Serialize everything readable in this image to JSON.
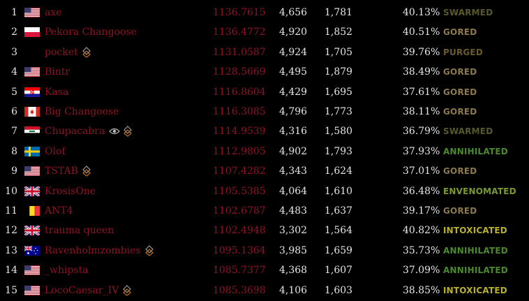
{
  "colors": {
    "background": "#000000",
    "name": "#8e1326",
    "rating": "#8e1326",
    "number": "#e6e6e6",
    "status": {
      "SWARMED": "#59582a",
      "GORED": "#8c7a4c",
      "PURGED": "#6b5a2c",
      "ANNIHILATED": "#4b8a2c",
      "ENVENOMATED": "#7a9a2c",
      "INTOXICATED": "#b8b02a"
    }
  },
  "rows": [
    {
      "rank": "1",
      "flag": "us-flag-icon",
      "name": "axe",
      "icons": [],
      "rating": "1136.7615",
      "games": "4,656",
      "wins": "1,781",
      "pct": "40.13%",
      "status": "SWARMED"
    },
    {
      "rank": "2",
      "flag": "pl-flag-icon",
      "name": "Pekora Changoose",
      "icons": [],
      "rating": "1136.4772",
      "games": "4,920",
      "wins": "1,852",
      "pct": "40.51%",
      "status": "GORED"
    },
    {
      "rank": "3",
      "flag": "",
      "name": "pocket",
      "icons": [
        "diamond-icon"
      ],
      "rating": "1131.0587",
      "games": "4,924",
      "wins": "1,705",
      "pct": "39.76%",
      "status": "PURGED"
    },
    {
      "rank": "4",
      "flag": "us-flag-icon",
      "name": "Bintr",
      "icons": [],
      "rating": "1128.5669",
      "games": "4,495",
      "wins": "1,879",
      "pct": "38.49%",
      "status": "GORED"
    },
    {
      "rank": "5",
      "flag": "hr-flag-icon",
      "name": "Kasa",
      "icons": [],
      "rating": "1116.8604",
      "games": "4,429",
      "wins": "1,695",
      "pct": "37.61%",
      "status": "GORED"
    },
    {
      "rank": "6",
      "flag": "ca-flag-icon",
      "name": "Big Changoose",
      "icons": [],
      "rating": "1116.3085",
      "games": "4,796",
      "wins": "1,773",
      "pct": "38.11%",
      "status": "GORED"
    },
    {
      "rank": "7",
      "flag": "iq-flag-icon",
      "name": "Chupacabra",
      "icons": [
        "eye-icon",
        "diamond-icon"
      ],
      "rating": "1114.9539",
      "games": "4,316",
      "wins": "1,580",
      "pct": "36.79%",
      "status": "SWARMED"
    },
    {
      "rank": "8",
      "flag": "se-flag-icon",
      "name": "Olof",
      "icons": [],
      "rating": "1112.9805",
      "games": "4,902",
      "wins": "1,793",
      "pct": "37.93%",
      "status": "ANNIHILATED"
    },
    {
      "rank": "9",
      "flag": "us-flag-icon",
      "name": "TSTAB",
      "icons": [
        "diamond-icon"
      ],
      "rating": "1107.4282",
      "games": "4,343",
      "wins": "1,624",
      "pct": "37.01%",
      "status": "GORED"
    },
    {
      "rank": "10",
      "flag": "uk-flag-icon",
      "name": "KrosisOne",
      "icons": [],
      "rating": "1105.5385",
      "games": "4,064",
      "wins": "1,610",
      "pct": "36.48%",
      "status": "ENVENOMATED"
    },
    {
      "rank": "11",
      "flag": "be-flag-icon",
      "name": "ANT4",
      "icons": [],
      "rating": "1102.6787",
      "games": "4,483",
      "wins": "1,637",
      "pct": "39.17%",
      "status": "GORED"
    },
    {
      "rank": "12",
      "flag": "uk-flag-icon",
      "name": "trauma queen",
      "icons": [],
      "rating": "1102.4948",
      "games": "3,302",
      "wins": "1,564",
      "pct": "40.82%",
      "status": "INTOXICATED"
    },
    {
      "rank": "13",
      "flag": "au-flag-icon",
      "name": "Ravenholmzombies",
      "icons": [
        "diamond-icon"
      ],
      "rating": "1095.1364",
      "games": "3,985",
      "wins": "1,659",
      "pct": "35.73%",
      "status": "ANNIHILATED"
    },
    {
      "rank": "14",
      "flag": "us-flag-icon",
      "name": "_whipsta",
      "icons": [],
      "rating": "1085.7377",
      "games": "4,368",
      "wins": "1,607",
      "pct": "37.09%",
      "status": "ANNIHILATED"
    },
    {
      "rank": "15",
      "flag": "us-flag-icon",
      "name": "LocoCaesar_IV",
      "icons": [
        "diamond-icon"
      ],
      "rating": "1085.3698",
      "games": "4,106",
      "wins": "1,603",
      "pct": "38.85%",
      "status": "INTOXICATED"
    }
  ]
}
